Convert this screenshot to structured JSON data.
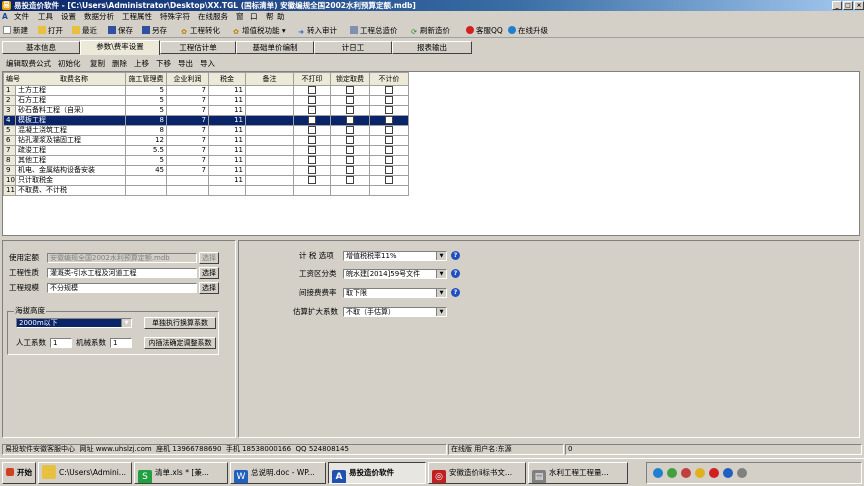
{
  "window": {
    "title": "易投造价软件 - [C:\\Users\\Administrator\\Desktop\\XX.TGL (国标清单) 安徽编规全国2002水利预算定额.mdb]",
    "minimize": "_",
    "maximize": "□",
    "close": "×"
  },
  "menu": [
    "文件",
    "工具",
    "设置",
    "数据分析",
    "工程属性",
    "特殊字符",
    "在线服务",
    "窗",
    "口",
    "帮",
    "助"
  ],
  "toolbar": {
    "new": "新建",
    "open": "打开",
    "recent": "最近",
    "save": "保存",
    "saveas": "另存",
    "convert": "工程转化",
    "vat": "增值税功能",
    "import": "转入审计",
    "summary": "工程总造价",
    "refresh": "刷新造价",
    "qq": "客服QQ",
    "upgrade": "在线升级"
  },
  "tabs": [
    "基本信息",
    "参数\\费率设置",
    "工程估计单",
    "基础单价编制",
    "计日工",
    "报表输出"
  ],
  "subtoolbar": [
    "编辑取费公式",
    "初始化",
    "复制",
    "删除",
    "上移",
    "下移",
    "导出",
    "导入"
  ],
  "grid": {
    "headers": [
      "编号",
      "取费名称",
      "施工管理费",
      "企业利润",
      "税金",
      "备注",
      "不打印",
      "锁定取费",
      "不计价"
    ],
    "rows": [
      {
        "no": "1",
        "name": "土方工程",
        "mgmt": "5",
        "profit": "7",
        "tax": "11"
      },
      {
        "no": "2",
        "name": "石方工程",
        "mgmt": "5",
        "profit": "7",
        "tax": "11"
      },
      {
        "no": "3",
        "name": "砂石备料工程（自采）",
        "mgmt": "5",
        "profit": "7",
        "tax": "11"
      },
      {
        "no": "4",
        "name": "模板工程",
        "mgmt": "8",
        "profit": "7",
        "tax": "11"
      },
      {
        "no": "5",
        "name": "混凝土浇筑工程",
        "mgmt": "8",
        "profit": "7",
        "tax": "11"
      },
      {
        "no": "6",
        "name": "钻孔灌浆及锚固工程",
        "mgmt": "12",
        "profit": "7",
        "tax": "11"
      },
      {
        "no": "7",
        "name": "疏浚工程",
        "mgmt": "5.5",
        "profit": "7",
        "tax": "11"
      },
      {
        "no": "8",
        "name": "其他工程",
        "mgmt": "5",
        "profit": "7",
        "tax": "11"
      },
      {
        "no": "9",
        "name": "机电、金属结构设备安装",
        "mgmt": "45",
        "profit": "7",
        "tax": "11"
      },
      {
        "no": "10",
        "name": "只计取税金",
        "mgmt": "",
        "profit": "",
        "tax": "11"
      },
      {
        "no": "11",
        "name": "不取费、不计税",
        "mgmt": "",
        "profit": "",
        "tax": ""
      }
    ],
    "selected_row": 4
  },
  "left_panel": {
    "quota_label": "使用定额",
    "quota_value": "安徽编规全国2002水利预算定额.mdb",
    "quota_button": "选择",
    "nature_label": "工程性质",
    "nature_value": "灌溉类-引水工程及河道工程",
    "nature_button": "选择",
    "scale_label": "工程规模",
    "scale_value": "不分规模",
    "scale_button": "选择",
    "altitude_group": "海拔高度",
    "altitude_value": "2000m以下",
    "single_adjust_button": "单独执行换算系数",
    "labor_label": "人工系数",
    "labor_value": "1",
    "machine_label": "机械系数",
    "machine_value": "1",
    "interp_button": "内插法确定调整系数"
  },
  "right_panel": {
    "tax_label": "计 税 选项",
    "tax_value": "增值税税率11%",
    "wage_label": "工资区分类",
    "wage_value": "皖水建[2014]59号文件",
    "rate_label": "间接费费率",
    "rate_value": "取下限",
    "expand_label": "估算扩大系数",
    "expand_value": "不取（手估算）"
  },
  "status": {
    "company": "易投软件安徽客服中心",
    "website_label": "网址",
    "website": "www.uhslzj.com",
    "landline_label": "座机",
    "landline": "13966788690",
    "mobile_label": "手机",
    "mobile": "18538000166",
    "qq_label": "QQ",
    "qq": "524808145",
    "online": "在线版 用户名:东源",
    "count": "0"
  },
  "taskbar": {
    "start": "开始",
    "items": [
      "C:\\Users\\Admini...",
      "清单.xls * [兼...",
      "总说明.doc - WP...",
      "易投造价软件",
      "安徽造价ⅱ标书文...",
      "水利工程工程量..."
    ]
  }
}
